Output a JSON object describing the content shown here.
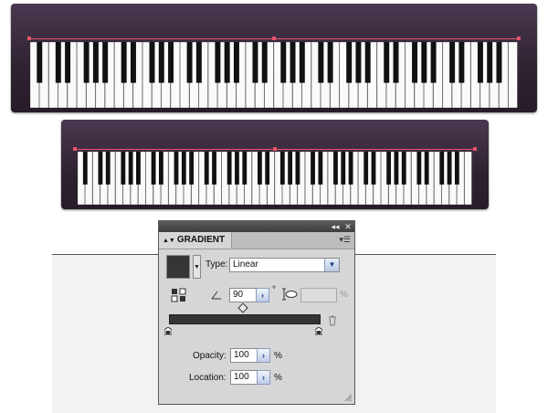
{
  "panel": {
    "tab_label": "GRADIENT",
    "type_label": "Type:",
    "type_value": "Linear",
    "angle_value": "90",
    "degree_symbol": "°",
    "aspect_unit": "%",
    "opacity_label": "Opacity:",
    "opacity_value": "100",
    "opacity_unit": "%",
    "location_label": "Location:",
    "location_value": "100",
    "location_unit": "%",
    "collapse_glyph": "◂◂",
    "close_glyph": "✕",
    "menu_glyph": "▾☰",
    "swatch_color": "#353535"
  },
  "colors": {
    "piano_top": "#4a3850",
    "piano_bottom": "#281c29",
    "selection": "#e8546a",
    "gradient_bar": "#353535"
  },
  "pianos": [
    {
      "white_keys": 52
    },
    {
      "white_keys": 52
    }
  ]
}
